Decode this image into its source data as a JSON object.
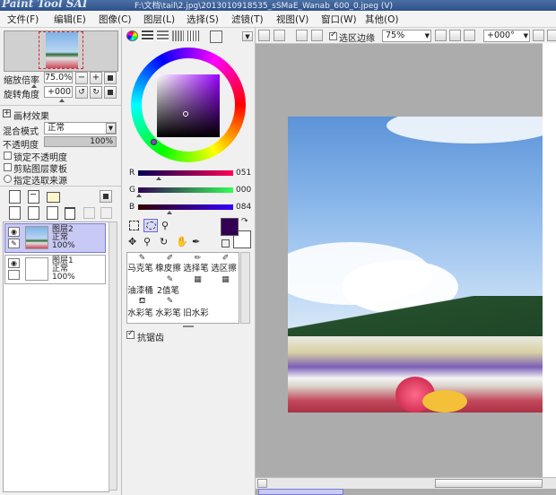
{
  "app": {
    "logo_text": "Paint Tool SAI",
    "title_path": "F:\\文档\\tail\\2.jpg\\2013010918535_sSMaE_Wanab_600_0.jpeg (V)"
  },
  "menu": [
    "文件(F)",
    "编辑(E)",
    "图像(C)",
    "图层(L)",
    "选择(S)",
    "滤镜(T)",
    "视图(V)",
    "窗口(W)",
    "其他(O)"
  ],
  "navigator": {
    "zoom_label": "缩放倍率",
    "zoom_value": "75.0%",
    "rotate_label": "旋转角度",
    "rotate_value": "+000"
  },
  "layer_props": {
    "effects_label": "画材效果",
    "blend_label": "混合模式",
    "blend_value": "正常",
    "opacity_label": "不透明度",
    "opacity_value": "100%",
    "checks": [
      "锁定不透明度",
      "剪贴图层蒙板",
      "指定选取来源"
    ]
  },
  "layers": [
    {
      "name": "图层2",
      "mode": "正常",
      "opacity": "100%",
      "selected": true
    },
    {
      "name": "图层1",
      "mode": "正常",
      "opacity": "100%",
      "selected": false
    }
  ],
  "color": {
    "R_label": "R",
    "R_value": "051",
    "G_label": "G",
    "G_value": "000",
    "B_label": "B",
    "B_value": "084",
    "current": "#330054"
  },
  "tools": {
    "row1": [
      "马克笔",
      "橡皮擦",
      "选择笔",
      "选区擦"
    ],
    "row2": [
      "油漆桶",
      "2值笔",
      "",
      ""
    ],
    "row3": [
      "水彩笔",
      "水彩笔",
      "旧水彩",
      ""
    ]
  },
  "antialias_label": "抗锯齿",
  "canvas_toolbar": {
    "selection_edge_label": "选区边缘",
    "zoom_select": "75%",
    "angle_select": "+000°"
  }
}
